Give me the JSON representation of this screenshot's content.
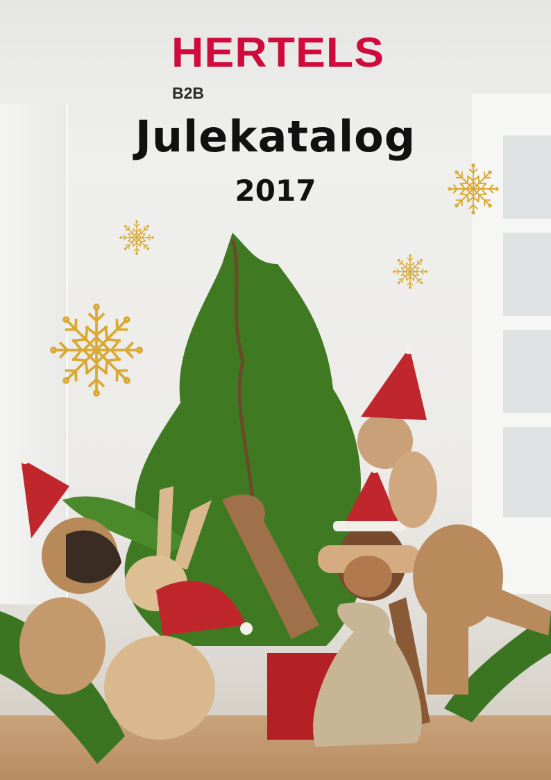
{
  "cover": {
    "brand": "HERTELS",
    "subbrand": "B2B",
    "title": "Julekatalog",
    "year": "2017"
  },
  "colors": {
    "brand": "#cf0a3c",
    "snowflake": "#d9a931",
    "tree": "#3f7a22",
    "hat": "#c0272d",
    "wood": "#c9a27a"
  },
  "icons": [
    "snowflake-icon"
  ]
}
